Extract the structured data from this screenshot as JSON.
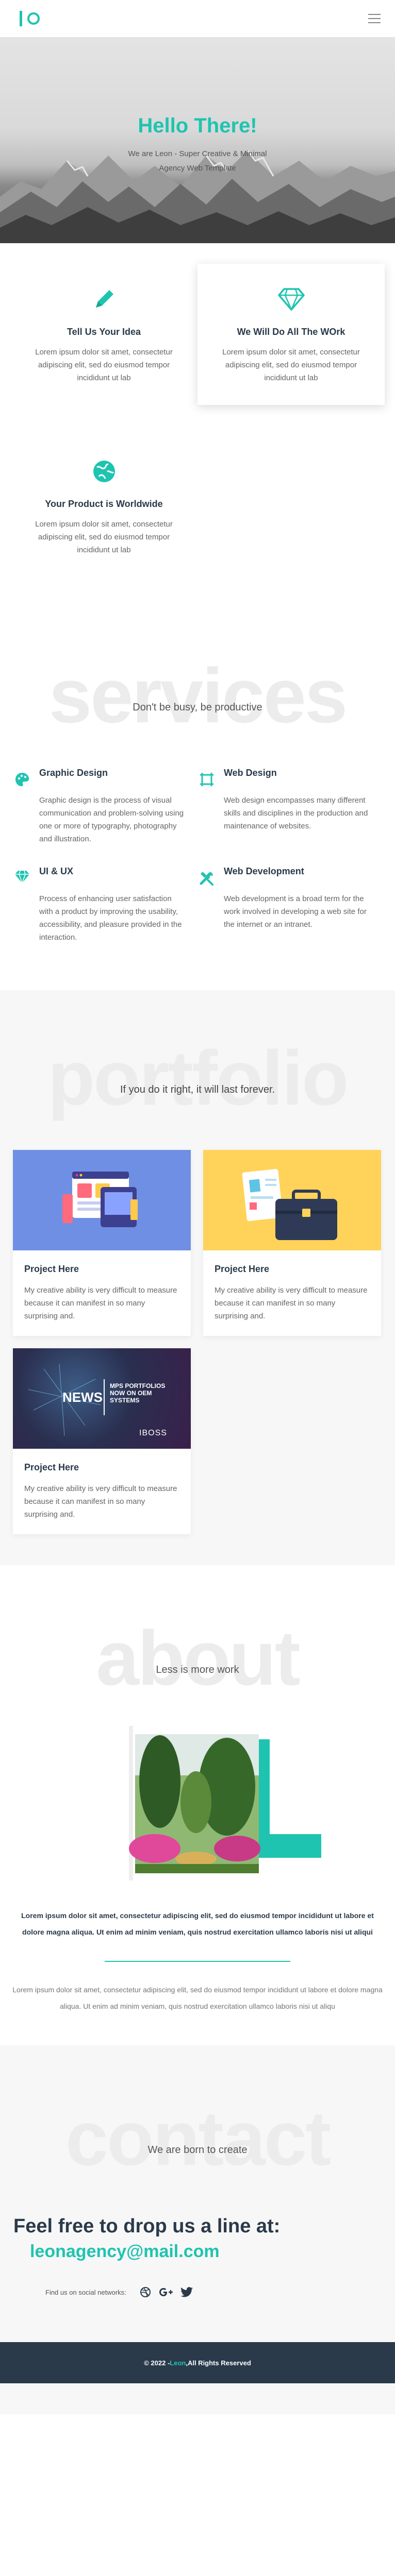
{
  "colors": {
    "accent": "#1ec4b0",
    "dark": "#2a3a4a"
  },
  "header": {
    "menu_icon": "hamburger-icon"
  },
  "hero": {
    "title": "Hello There!",
    "subtitle": "We are Leon - Super Creative & Minimal Agency Web Template"
  },
  "features": [
    {
      "icon": "pen-icon",
      "title": "Tell Us Your Idea",
      "text": "Lorem ipsum dolor sit amet, consectetur adipiscing elit, sed do eiusmod tempor incididunt ut lab"
    },
    {
      "icon": "diamond-icon",
      "title": "We Will Do All The WOrk",
      "text": "Lorem ipsum dolor sit amet, consectetur adipiscing elit, sed do eiusmod tempor incididunt ut lab"
    },
    {
      "icon": "globe-icon",
      "title": "Your Product is Worldwide",
      "text": "Lorem ipsum dolor sit amet, consectetur adipiscing elit, sed do eiusmod tempor incididunt ut lab"
    }
  ],
  "services": {
    "ghost": "services",
    "tagline": "Don't be busy, be productive",
    "items": [
      {
        "icon": "palette-icon",
        "title": "Graphic Design",
        "text": "Graphic design is the process of visual communication and problem-solving using one or more of typography, photography and illustration."
      },
      {
        "icon": "crop-icon",
        "title": "Web Design",
        "text": "Web design encompasses many different skills and disciplines in the production and maintenance of websites."
      },
      {
        "icon": "diamond-icon",
        "title": "UI & UX",
        "text": "Process of enhancing user satisfaction with a product by improving the usability, accessibility, and pleasure provided in the interaction."
      },
      {
        "icon": "tools-icon",
        "title": "Web Development",
        "text": "Web development is a broad term for the work involved in developing a web site for the internet or an intranet."
      }
    ]
  },
  "portfolio": {
    "ghost": "portfolio",
    "tagline": "If you do it right, it will last forever.",
    "items": [
      {
        "title": "Project Here",
        "text": "My creative ability is very difficult to measure because it can manifest in so many surprising and."
      },
      {
        "title": "Project Here",
        "text": "My creative ability is very difficult to measure because it can manifest in so many surprising and."
      },
      {
        "title": "Project Here",
        "text": "My creative ability is very difficult to measure because it can manifest in so many surprising and.",
        "image_text": {
          "news": "NEWS",
          "caption": "MPS PORTFOLIOS NOW ON OEM SYSTEMS",
          "brand": "IBOSS"
        }
      }
    ]
  },
  "about": {
    "ghost": "about",
    "tagline": "Less is more work",
    "bold_text": "Lorem ipsum dolor sit amet, consectetur adipiscing elit, sed do eiusmod tempor incididunt ut labore et dolore magna aliqua. Ut enim ad minim veniam, quis nostrud exercitation ullamco laboris nisi ut aliqui",
    "text": "Lorem ipsum dolor sit amet, consectetur adipiscing elit, sed do eiusmod tempor incididunt ut labore et dolore magna aliqua. Ut enim ad minim veniam, quis nostrud exercitation ullamco laboris nisi ut aliqu"
  },
  "contact": {
    "ghost": "contact",
    "tagline": "We are born to create",
    "headline": "Feel free to drop us a line at:",
    "email": "leonagency@mail.com",
    "social_label": "Find us on social networks:",
    "social": [
      "dribbble-icon",
      "google-plus-icon",
      "twitter-icon"
    ]
  },
  "footer": {
    "prefix": "© 2022 - ",
    "brand": "Leon",
    "suffix": ",All Rights Reserved"
  }
}
